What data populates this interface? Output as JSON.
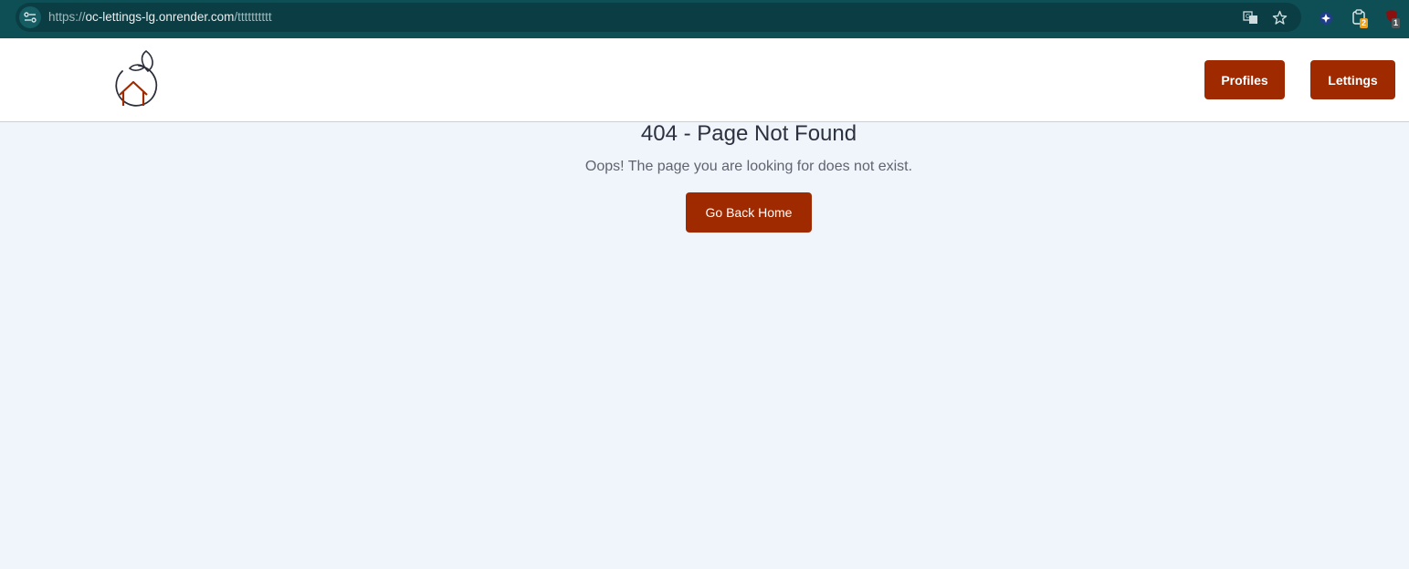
{
  "browser": {
    "url_prefix": "https://",
    "url_host": "oc-lettings-lg.onrender.com",
    "url_path": "/tttttttttt",
    "extensions": [
      {
        "icon": "puzzle-diamond-icon",
        "badge": ""
      },
      {
        "icon": "clipboard-extension-icon",
        "badge": "2"
      },
      {
        "icon": "shield-extension-icon",
        "badge": "1"
      }
    ]
  },
  "header": {
    "logo_icon": "house-in-circle-logo",
    "nav": {
      "profiles": "Profiles",
      "lettings": "Lettings"
    }
  },
  "main": {
    "title": "404 - Page Not Found",
    "message": "Oops! The page you are looking for does not exist.",
    "home_button": "Go Back Home"
  },
  "colors": {
    "browser_bar": "#0e4e55",
    "accent": "#a02a00",
    "page_bg": "#f0f4fb"
  }
}
